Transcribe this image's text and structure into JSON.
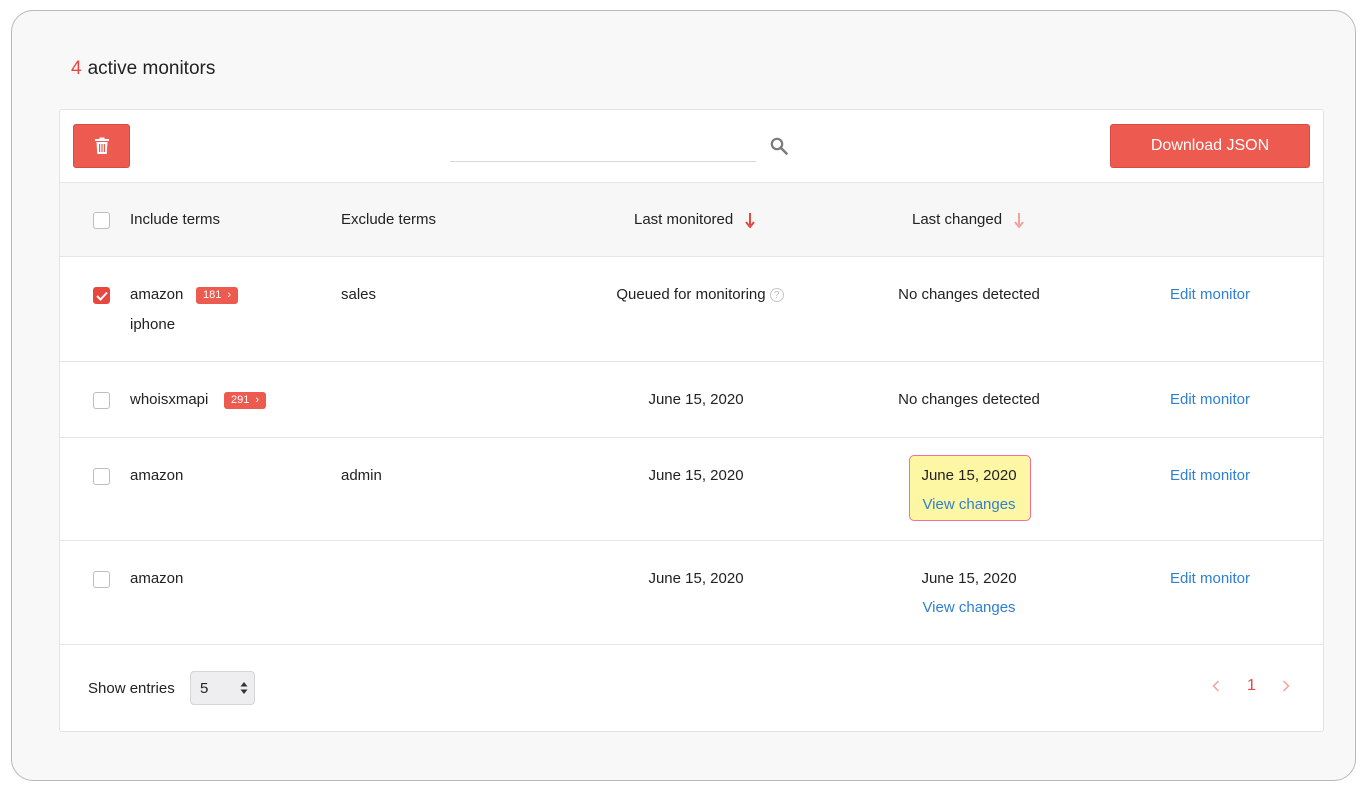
{
  "heading": {
    "count": "4",
    "label": "active monitors"
  },
  "toolbar": {
    "delete_icon": "trash-icon",
    "search_placeholder": "",
    "search_icon": "search-icon",
    "download_label": "Download JSON"
  },
  "table": {
    "headers": {
      "include": "Include terms",
      "exclude": "Exclude terms",
      "last_monitored": "Last monitored",
      "last_changed": "Last changed"
    },
    "rows": [
      {
        "checked": true,
        "include": "amazon",
        "include_extra": "iphone",
        "badge": "181",
        "exclude": "sales",
        "last_monitored": "Queued for monitoring",
        "last_changed": "No changes detected",
        "action": "Edit monitor"
      },
      {
        "checked": false,
        "include": "whoisxmapi",
        "badge": "291",
        "exclude": "",
        "last_monitored": "June 15, 2020",
        "last_changed": "No changes detected",
        "action": "Edit monitor"
      },
      {
        "checked": false,
        "include": "amazon",
        "exclude": "admin",
        "last_monitored": "June 15, 2020",
        "last_changed": "June 15, 2020",
        "view_changes": "View changes",
        "action": "Edit monitor"
      },
      {
        "checked": false,
        "include": "amazon",
        "exclude": "",
        "last_monitored": "June 15, 2020",
        "last_changed": "June 15, 2020",
        "view_changes": "View changes",
        "action": "Edit monitor"
      }
    ]
  },
  "footer": {
    "show_entries_label": "Show entries",
    "entries_value": "5",
    "current_page": "1"
  },
  "colors": {
    "accent": "#e8473f",
    "link": "#2f80d1",
    "highlight": "#fdf6a3"
  }
}
